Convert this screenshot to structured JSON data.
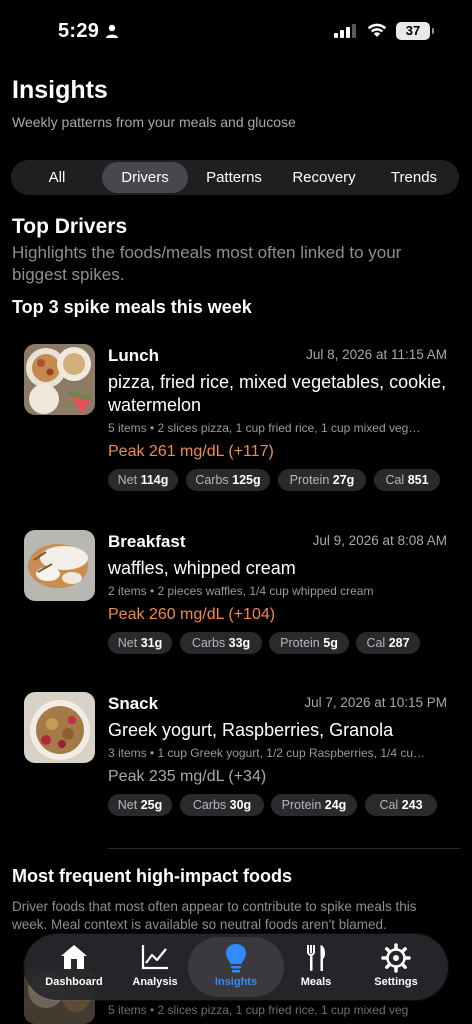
{
  "status_bar": {
    "time": "5:29",
    "battery": "37"
  },
  "header": {
    "title": "Insights",
    "subtitle": "Weekly patterns from your meals and glucose"
  },
  "segments": [
    {
      "label": "All",
      "active": false
    },
    {
      "label": "Drivers",
      "active": true
    },
    {
      "label": "Patterns",
      "active": false
    },
    {
      "label": "Recovery",
      "active": false
    },
    {
      "label": "Trends",
      "active": false
    }
  ],
  "top_drivers": {
    "title": "Top Drivers",
    "description": "Highlights the foods/meals most often linked to your biggest spikes.",
    "subtitle": "Top 3 spike meals this week"
  },
  "meals": [
    {
      "type": "Lunch",
      "date": "Jul 8, 2026 at 11:15 AM",
      "foods": "pizza, fried rice, mixed vegetables, cookie, watermelon",
      "items": "5 items • 2 slices pizza, 1 cup fried rice, 1 cup mixed veg…",
      "peak": "Peak 261 mg/dL (+117)",
      "peak_color": "#f08a4b",
      "macros": [
        {
          "label": "Net",
          "value": "114g"
        },
        {
          "label": "Carbs",
          "value": "125g"
        },
        {
          "label": "Protein",
          "value": "27g"
        },
        {
          "label": "Cal",
          "value": "851"
        }
      ]
    },
    {
      "type": "Breakfast",
      "date": "Jul 9, 2026 at 8:08 AM",
      "foods": "waffles, whipped cream",
      "items": "2 items • 2 pieces waffles, 1/4 cup whipped cream",
      "peak": "Peak 260 mg/dL (+104)",
      "peak_color": "#f08a4b",
      "macros": [
        {
          "label": "Net",
          "value": "31g"
        },
        {
          "label": "Carbs",
          "value": "33g"
        },
        {
          "label": "Protein",
          "value": "5g"
        },
        {
          "label": "Cal",
          "value": "287"
        }
      ]
    },
    {
      "type": "Snack",
      "date": "Jul 7, 2026 at 10:15 PM",
      "foods": "Greek yogurt, Raspberries, Granola",
      "items": "3 items • 1 cup Greek yogurt, 1/2 cup Raspberries, 1/4 cu…",
      "peak": "Peak 235 mg/dL (+34)",
      "peak_color": "#a8a8ad",
      "macros": [
        {
          "label": "Net",
          "value": "25g"
        },
        {
          "label": "Carbs",
          "value": "30g"
        },
        {
          "label": "Protein",
          "value": "24g"
        },
        {
          "label": "Cal",
          "value": "243"
        }
      ]
    }
  ],
  "frequent_foods": {
    "title": "Most frequent high-impact foods",
    "description": "Driver foods that most often appear to contribute to spike meals this week. Meal context is available so neutral foods aren't blamed.",
    "peek_text": "5 items • 2 slices pizza, 1 cup fried rice, 1 cup mixed veg"
  },
  "tab_bar": [
    {
      "label": "Dashboard",
      "icon": "house-icon",
      "active": false
    },
    {
      "label": "Analysis",
      "icon": "line-chart-icon",
      "active": false
    },
    {
      "label": "Insights",
      "icon": "lightbulb-icon",
      "active": true
    },
    {
      "label": "Meals",
      "icon": "fork-knife-icon",
      "active": false
    },
    {
      "label": "Settings",
      "icon": "gear-icon",
      "active": false
    }
  ],
  "colors": {
    "accent": "#2f8cff",
    "peak_warning": "#f08a4b",
    "background": "#000000"
  }
}
